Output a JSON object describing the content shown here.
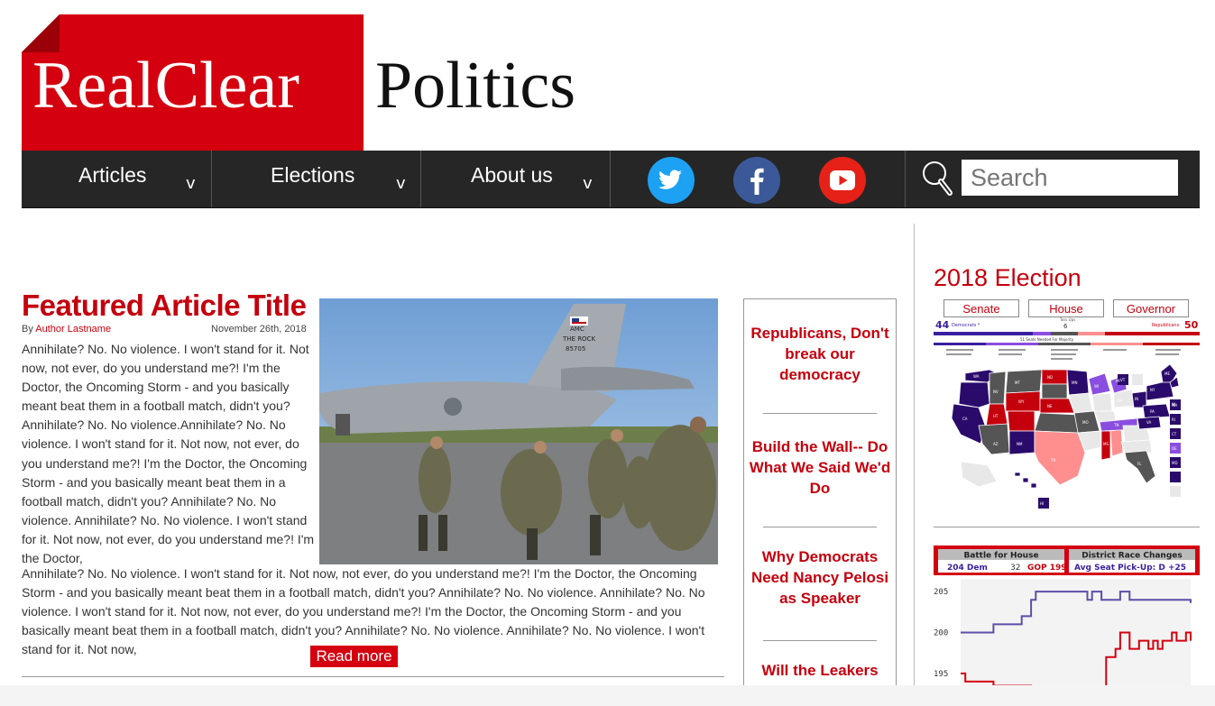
{
  "logo": {
    "left": "RealClear",
    "right": "Politics"
  },
  "nav": {
    "items": [
      {
        "label": "Articles"
      },
      {
        "label": "Elections"
      },
      {
        "label": "About us"
      }
    ],
    "chevron": "v",
    "search_placeholder": "Search"
  },
  "social": [
    "twitter-icon",
    "facebook-icon",
    "youtube-icon"
  ],
  "featured": {
    "title": "Featured Article Title",
    "by": "By",
    "author": "Author Lastname",
    "date": "November 26th, 2018",
    "body_a": "Annihilate? No. No violence. I won't stand for it. Not now, not ever, do you understand me?! I'm the Doctor, the Oncoming Storm - and you basically meant beat them in a football match, didn't you? Annihilate? No. No violence.Annihilate? No. No violence. I won't stand for it. Not now, not ever, do you understand me?! I'm the Doctor, the Oncoming Storm - and you basically meant beat them in a football match, didn't you? Annihilate? No. No violence. Annihilate? No. No violence. I won't stand for it. Not now, not ever, do you understand me?! I'm the Doctor,",
    "body_b": "Annihilate? No. No violence. I won't stand for it. Not now, not ever, do you understand me?! I'm the Doctor, the Oncoming Storm - and you basically meant beat them in a football match, didn't you? Annihilate? No. No violence. Annihilate? No. No violence. I won't stand for it. Not now, not ever, do you understand me?! I'm the Doctor, the Oncoming Storm - and you basically meant beat them in a football match, didn't you? Annihilate? No. No violence. Annihilate? No. No violence. I won't stand for it. Not now,",
    "read_more": "Read more",
    "image_text": {
      "amc": "AMC",
      "rock": "THE ROCK",
      "tail": "85705"
    }
  },
  "sidebar_links": [
    "Republicans, Don't break our democracy",
    "Build the Wall-- Do What We Said We'd Do",
    "Why Democrats Need Nancy Pelosi as Speaker",
    "Will the Leakers"
  ],
  "election": {
    "title": "2018 Election",
    "tabs": [
      "Senate",
      "House",
      "Governor"
    ],
    "dem_seats": "44",
    "rep_seats": "50",
    "dem_label": "Democrats *",
    "rep_label": "Republicans",
    "tossup_label": "Toss Ups",
    "tossup_count": "6",
    "majority_note": "51 Seats Needed For Majority",
    "state_labels": [
      "WA",
      "MT",
      "ND",
      "MN",
      "WI",
      "MI",
      "NY",
      "ME",
      "VT",
      "CA",
      "NV",
      "UT",
      "WY",
      "NE",
      "MO",
      "OH",
      "PA",
      "NJ",
      "AZ",
      "NM",
      "TX",
      "MS",
      "FL",
      "HI",
      "MA",
      "RI",
      "CT",
      "DE",
      "MD",
      "VA",
      "TN",
      "IN",
      "WV"
    ],
    "colors": {
      "solid_dem": "#2a0b6b",
      "likely_dem": "#8a4de0",
      "tossup": "#555555",
      "likely_rep": "#ff8f8f",
      "solid_rep": "#c4000d",
      "none": "#e8e8e8"
    }
  },
  "house_widget": {
    "battle_label": "Battle for House",
    "dem": "204 Dem",
    "tossup": "32",
    "gop": "GOP 199",
    "change_label": "District Race Changes",
    "pickup": "Avg Seat Pick-Up: D +25",
    "chart_data": {
      "type": "line",
      "title": "",
      "xlabel": "",
      "ylabel": "",
      "yticks": [
        205,
        200,
        195
      ],
      "ylim": [
        193,
        207
      ],
      "series": [
        {
          "color": "#5b4fa8",
          "values": [
            200,
            200,
            200,
            200,
            200,
            200,
            200,
            201,
            201,
            201,
            201,
            201,
            201,
            202,
            202,
            204,
            205,
            205,
            205,
            205,
            205,
            205,
            205,
            205,
            205,
            205,
            205,
            204,
            205,
            205,
            204,
            204,
            204,
            204,
            205,
            205,
            204,
            204,
            204,
            204,
            204,
            204,
            204,
            204,
            204,
            204,
            204,
            204,
            204,
            203.6
          ]
        },
        {
          "color": "#d4000f",
          "values": [
            195,
            194,
            194,
            194,
            194,
            194,
            194,
            193.5,
            193.5,
            193.5,
            193.5,
            193.5,
            193.5,
            193.5,
            193.5,
            193,
            193,
            193,
            193,
            193,
            193,
            193,
            193,
            193,
            193,
            193,
            193,
            193,
            193,
            193,
            193,
            197,
            197,
            198,
            200,
            200,
            198,
            198,
            199,
            199,
            198,
            199,
            198,
            199,
            199,
            200,
            199,
            199,
            200,
            199
          ]
        }
      ]
    }
  }
}
